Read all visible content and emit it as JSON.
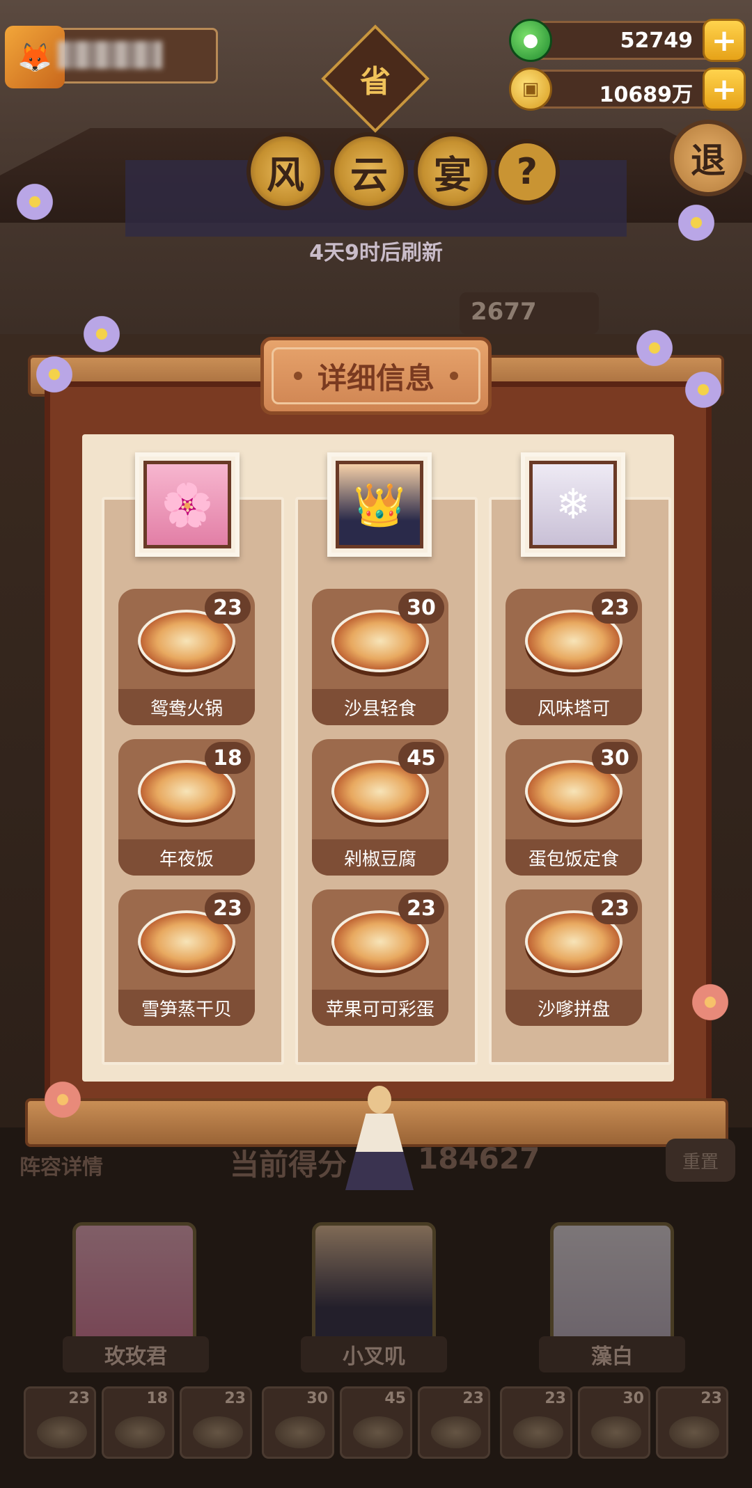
{
  "header": {
    "currency_jade": {
      "value": "52749",
      "icon": "jade-icon"
    },
    "currency_coin": {
      "value": "10689万",
      "icon": "coin-icon"
    },
    "plus_label": "+",
    "province_badge": "省",
    "title_chars": [
      "风",
      "云",
      "宴"
    ],
    "help_label": "?",
    "exit_label": "退",
    "refresh_text": "4天9时后刷新",
    "score_peek": "2677"
  },
  "panel": {
    "title": "详细信息",
    "columns": [
      {
        "portrait": "character-portrait-pink",
        "dishes": [
          {
            "name": "鸳鸯火锅",
            "count": "23"
          },
          {
            "name": "年夜饭",
            "count": "18"
          },
          {
            "name": "雪笋蒸干贝",
            "count": "23"
          }
        ]
      },
      {
        "portrait": "character-portrait-dark-hair",
        "dishes": [
          {
            "name": "沙县轻食",
            "count": "30"
          },
          {
            "name": "剁椒豆腐",
            "count": "45"
          },
          {
            "name": "苹果可可彩蛋",
            "count": "23"
          }
        ]
      },
      {
        "portrait": "character-portrait-white-hair",
        "dishes": [
          {
            "name": "风味塔可",
            "count": "23"
          },
          {
            "name": "蛋包饭定食",
            "count": "30"
          },
          {
            "name": "沙嗲拼盘",
            "count": "23"
          }
        ]
      }
    ]
  },
  "lower": {
    "lineup_label": "阵容详情",
    "score_label": "当前得分",
    "score_value": "184627",
    "reset_label": "重置",
    "chefs": [
      "玫玫君",
      "小叉叽",
      "藻白"
    ],
    "mini_dishes": [
      "23",
      "18",
      "23",
      "30",
      "45",
      "23",
      "23",
      "30",
      "23"
    ]
  },
  "colors": {
    "panel_bg": "#f2e3cc",
    "dish_card": "#9c6a4c",
    "frame": "#7a3a22",
    "accent_gold": "#e6a218"
  }
}
